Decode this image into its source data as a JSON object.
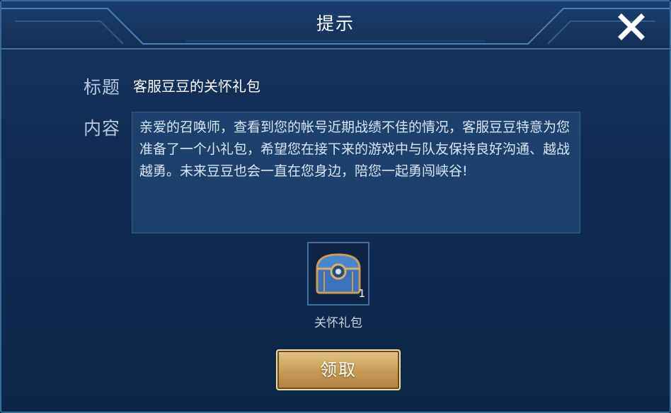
{
  "dialog": {
    "title": "提示",
    "close_icon": "close-icon"
  },
  "mail": {
    "subject_label": "标题",
    "subject": "客服豆豆的关怀礼包",
    "content_label": "内容",
    "content": "亲爱的召唤师，查看到您的帐号近期战绩不佳的情况，客服豆豆特意为您准备了一个小礼包，希望您在接下来的游戏中与队友保持良好沟通、越战越勇。未来豆豆也会一直在您身边，陪您一起勇闯峡谷!"
  },
  "attachment": {
    "icon": "treasure-chest-icon",
    "count": "1",
    "name": "关怀礼包"
  },
  "actions": {
    "claim_label": "领取"
  },
  "colors": {
    "panel": "#102b52",
    "accent_border": "#3d74a6",
    "button_gold": "#c79a52"
  }
}
